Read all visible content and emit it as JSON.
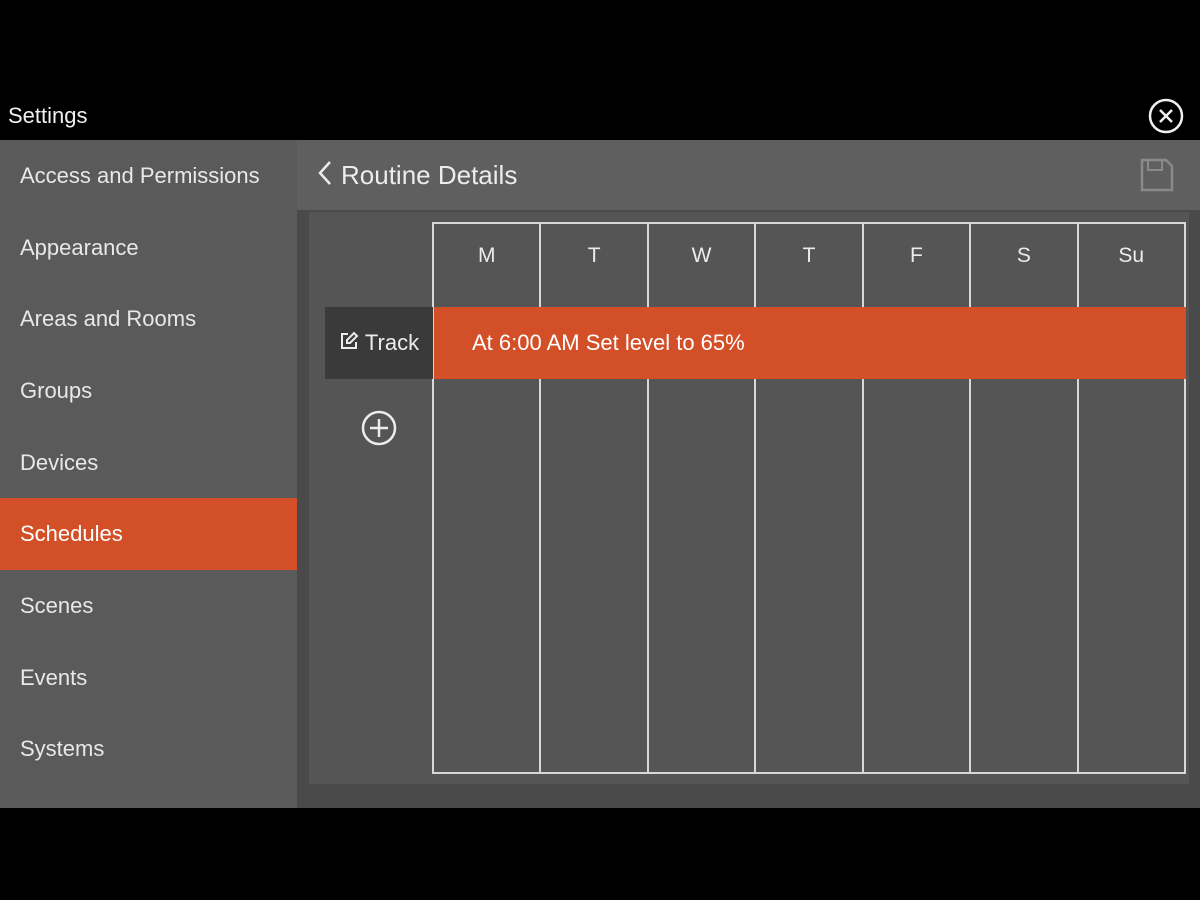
{
  "window": {
    "title": "Settings",
    "close_icon": "close-circle-icon"
  },
  "sidebar": {
    "active_color": "#d24f28",
    "items": [
      {
        "label": "Access and Permissions"
      },
      {
        "label": "Appearance"
      },
      {
        "label": "Areas and Rooms"
      },
      {
        "label": "Groups"
      },
      {
        "label": "Devices"
      },
      {
        "label": "Schedules",
        "active": true
      },
      {
        "label": "Scenes"
      },
      {
        "label": "Events"
      },
      {
        "label": "Systems"
      }
    ]
  },
  "header": {
    "back_icon": "chevron-left-icon",
    "title": "Routine Details",
    "save_icon": "save-floppy-icon"
  },
  "schedule": {
    "days": [
      "M",
      "T",
      "W",
      "T",
      "F",
      "S",
      "Su"
    ],
    "tracks": [
      {
        "label": "Track",
        "icon": "edit-icon",
        "event": "At 6:00 AM Set level to 65%"
      }
    ],
    "add_icon": "plus-circle-icon"
  }
}
